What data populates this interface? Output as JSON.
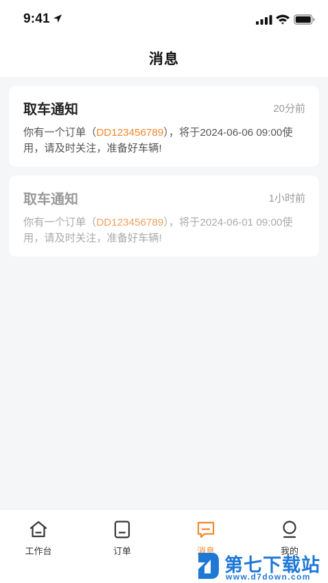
{
  "status_bar": {
    "time": "9:41"
  },
  "header": {
    "title": "消息"
  },
  "messages": [
    {
      "title": "取车通知",
      "time": "20分前",
      "text_before": "你有一个订单（",
      "order_no": "DD123456789",
      "text_after": "），将于2024-06-06 09:00使用，请及时关注，准备好车辆!",
      "read": false
    },
    {
      "title": "取车通知",
      "time": "1小时前",
      "text_before": "你有一个订单（",
      "order_no": "DD123456789",
      "text_after": "），将于2024-06-01 09:00使用，请及时关注，准备好车辆!",
      "read": true
    }
  ],
  "tabs": [
    {
      "label": "工作台",
      "icon": "home-icon",
      "active": false
    },
    {
      "label": "订单",
      "icon": "order-icon",
      "active": false
    },
    {
      "label": "消息",
      "icon": "message-icon",
      "active": true
    },
    {
      "label": "我的",
      "icon": "profile-icon",
      "active": false
    }
  ],
  "colors": {
    "accent": "#f0872a",
    "watermark": "#1e78d6"
  },
  "watermark": {
    "name": "第七下载站",
    "url": "www.d7down.com"
  }
}
